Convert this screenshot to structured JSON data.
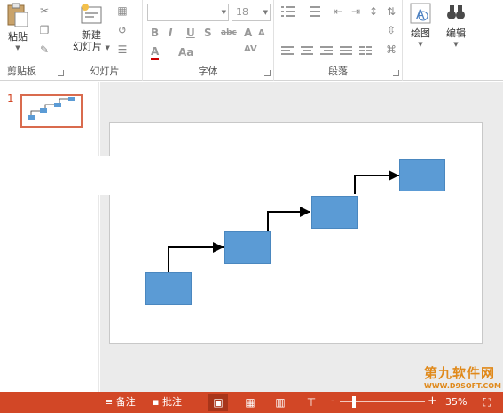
{
  "ribbon": {
    "clipboard": {
      "paste_label": "粘贴",
      "group_label": "剪贴板"
    },
    "slides": {
      "new_slide_line1": "新建",
      "new_slide_line2": "幻灯片",
      "group_label": "幻灯片"
    },
    "font": {
      "font_name_placeholder": "",
      "font_size": "18",
      "bold": "B",
      "italic": "I",
      "underline": "U",
      "shadow": "S",
      "strike": "abc",
      "spacing": "AV",
      "font_color": "A",
      "change_case": "Aa",
      "grow": "A",
      "shrink": "A",
      "group_label": "字体"
    },
    "paragraph": {
      "group_label": "段落"
    },
    "drawing": {
      "label": "绘图"
    },
    "editing": {
      "label": "编辑"
    }
  },
  "thumbnails": {
    "slide_number": "1"
  },
  "status_bar": {
    "notes_label": "备注",
    "comments_label": "批注",
    "zoom_minus": "-",
    "zoom_plus": "+",
    "zoom_percent": "35%",
    "zoom_level": 0.35
  },
  "watermark": {
    "main": "第九软件网",
    "sub": "WWW.D9SOFT.COM"
  },
  "colors": {
    "accent": "#d24726",
    "shape_fill": "#5b9bd5",
    "connector": "#000000"
  }
}
